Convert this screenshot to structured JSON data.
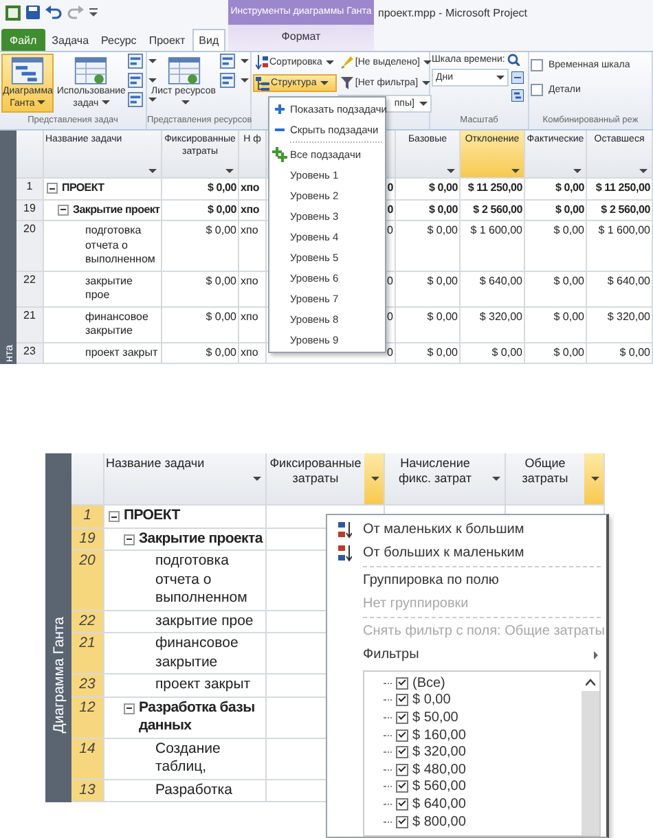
{
  "top": {
    "title_bar": {
      "context_group": "Инструменты диаграммы Ганта",
      "title": "проект.mpp - Microsoft Project"
    },
    "tabs": [
      {
        "label": "Файл",
        "kind": "file",
        "selected": false
      },
      {
        "label": "Задача",
        "kind": "main",
        "selected": false
      },
      {
        "label": "Ресурс",
        "kind": "main",
        "selected": false
      },
      {
        "label": "Проект",
        "kind": "main",
        "selected": false
      },
      {
        "label": "Вид",
        "kind": "main",
        "selected": true
      },
      {
        "label": "Формат",
        "kind": "context",
        "selected": false
      }
    ],
    "ribbon": [
      {
        "kind": "views",
        "label": "Представления задач",
        "buttons": [
          {
            "label": "Диаграмма Ганта",
            "selected": true
          },
          {
            "label": "Использование задач",
            "selected": false
          }
        ]
      },
      {
        "kind": "views",
        "label": "Представления ресурсов",
        "buttons": [
          {
            "label": "Лист ресурсов",
            "selected": false
          }
        ]
      },
      {
        "kind": "data",
        "sort": "Сортировка",
        "outline": {
          "label": "Структура",
          "selected": true
        },
        "highlight": "[Не выделено]",
        "filter": "[Нет фильтра]",
        "group": "ппы]"
      },
      {
        "kind": "zoom",
        "label": "Масштаб",
        "timescale_label": "Шкала времени:",
        "timescale": "Дни"
      },
      {
        "kind": "split",
        "label": "Комбинированный реж",
        "checks": [
          {
            "label": "Временная шкала",
            "checked": false
          },
          {
            "label": "Детали",
            "checked": false
          }
        ]
      }
    ],
    "outline_menu": [
      {
        "kind": "show",
        "label": "Показать подзадачи"
      },
      {
        "kind": "hide",
        "label": "Скрыть подзадачи"
      },
      {
        "kind": "all",
        "label": "Все подзадачи"
      },
      {
        "kind": "level",
        "label": "Уровень 1"
      },
      {
        "kind": "level",
        "label": "Уровень 2"
      },
      {
        "kind": "level",
        "label": "Уровень 3"
      },
      {
        "kind": "level",
        "label": "Уровень 4"
      },
      {
        "kind": "level",
        "label": "Уровень 5"
      },
      {
        "kind": "level",
        "label": "Уровень 6"
      },
      {
        "kind": "level",
        "label": "Уровень 7"
      },
      {
        "kind": "level",
        "label": "Уровень 8"
      },
      {
        "kind": "level",
        "label": "Уровень 9"
      }
    ],
    "table": {
      "view_bar": "нта",
      "name_column": {
        "label": "Название задачи"
      },
      "columns": [
        {
          "label": "Фиксированные затраты",
          "highlighted": false
        },
        {
          "label": "Н ф",
          "highlighted": false
        },
        {
          "highlighted": false
        },
        {
          "label": "Базовые",
          "highlighted": false
        },
        {
          "label": "Отклонение",
          "highlighted": true
        },
        {
          "label": "Фактические",
          "highlighted": false
        },
        {
          "label": "Оставшеся",
          "highlighted": false
        }
      ],
      "rows": [
        {
          "id": "1",
          "name": "ПРОЕКТ",
          "selected": false,
          "expanded": true,
          "cells": [
            "$ 0,00",
            "хпо",
            "0",
            "$ 0,00",
            "$ 11 250,00",
            "$ 0,00",
            "$ 11 250,00"
          ],
          "children": [
            {
              "id": "19",
              "name": "Закрытие проект",
              "selected": false,
              "expanded": true,
              "cells": [
                "$ 0,00",
                "хпо",
                "0",
                "$ 0,00",
                "$ 2 560,00",
                "$ 0,00",
                "$ 2 560,00"
              ],
              "children": [
                {
                  "id": "20",
                  "name": "подготовка отчета о выполненном",
                  "selected": false,
                  "cells": [
                    "$ 0,00",
                    "хпо",
                    "0",
                    "$ 0,00",
                    "$ 1 600,00",
                    "$ 0,00",
                    "$ 1 600,00"
                  ]
                },
                {
                  "id": "22",
                  "name": "закрытие прое",
                  "selected": false,
                  "cells": [
                    "$ 0,00",
                    "хпо",
                    "0",
                    "$ 0,00",
                    "$ 640,00",
                    "$ 0,00",
                    "$ 640,00"
                  ]
                },
                {
                  "id": "21",
                  "name": "финансовое закрытие",
                  "selected": false,
                  "cells": [
                    "$ 0,00",
                    "хпо",
                    "0",
                    "$ 0,00",
                    "$ 320,00",
                    "$ 0,00",
                    "$ 320,00"
                  ]
                },
                {
                  "id": "23",
                  "name": "проект закрыт",
                  "selected": false,
                  "cells": [
                    "$ 0,00",
                    "хпо",
                    "0",
                    "$ 0,00",
                    "$ 0,00",
                    "$ 0,00",
                    "$ 0,00"
                  ]
                }
              ]
            }
          ]
        }
      ]
    }
  },
  "bottom": {
    "table": {
      "view_bar": "Диаграмма Ганта",
      "name_column": {
        "label": "Название задачи"
      },
      "columns": [
        {
          "label": "Фиксированные затраты",
          "highlighted": true
        },
        {
          "label": "Начисление фикс. затрат",
          "highlighted": false
        },
        {
          "label": "Общие затраты",
          "highlighted": true
        }
      ],
      "rows": [
        {
          "id": "1",
          "name": "ПРОЕКТ",
          "selected": true,
          "expanded": true,
          "children": [
            {
              "id": "19",
              "name": "Закрытие проекта",
              "selected": true,
              "expanded": true,
              "children": [
                {
                  "id": "20",
                  "name": "подготовка отчета о выполненном",
                  "selected": true
                },
                {
                  "id": "22",
                  "name": "закрытие прое",
                  "selected": true
                },
                {
                  "id": "21",
                  "name": "финансовое закрытие",
                  "selected": true
                },
                {
                  "id": "23",
                  "name": "проект закрыт",
                  "selected": true
                }
              ]
            },
            {
              "id": "12",
              "name": "Разработка базы данных",
              "selected": true,
              "expanded": true,
              "children": [
                {
                  "id": "14",
                  "name": "Создание таблиц,",
                  "selected": true
                },
                {
                  "id": "13",
                  "name": "Разработка",
                  "selected": true
                }
              ]
            }
          ]
        }
      ]
    },
    "column_menu": {
      "items": [
        {
          "kind": "sort_asc",
          "label": "От маленьких к большим",
          "disabled": false,
          "submenu": false
        },
        {
          "kind": "sort_desc",
          "label": "От больших к маленьким",
          "disabled": false,
          "submenu": false
        },
        {
          "kind": "group",
          "label": "Группировка по полю",
          "disabled": false,
          "submenu": false
        },
        {
          "kind": "group",
          "label": "Нет группировки",
          "disabled": true,
          "submenu": false
        },
        {
          "kind": "filter",
          "label": "Снять фильтр с поля: Общие затраты",
          "disabled": true,
          "submenu": false
        },
        {
          "kind": "filter",
          "label": "Фильтры",
          "disabled": false,
          "submenu": true
        }
      ],
      "values": [
        {
          "label": "(Все)",
          "checked": true
        },
        {
          "label": "$ 0,00",
          "checked": true
        },
        {
          "label": "$ 50,00",
          "checked": true
        },
        {
          "label": "$ 160,00",
          "checked": true
        },
        {
          "label": "$ 320,00",
          "checked": true
        },
        {
          "label": "$ 480,00",
          "checked": true
        },
        {
          "label": "$ 560,00",
          "checked": true
        },
        {
          "label": "$ 640,00",
          "checked": true
        },
        {
          "label": "$ 800,00",
          "checked": true
        }
      ]
    }
  }
}
